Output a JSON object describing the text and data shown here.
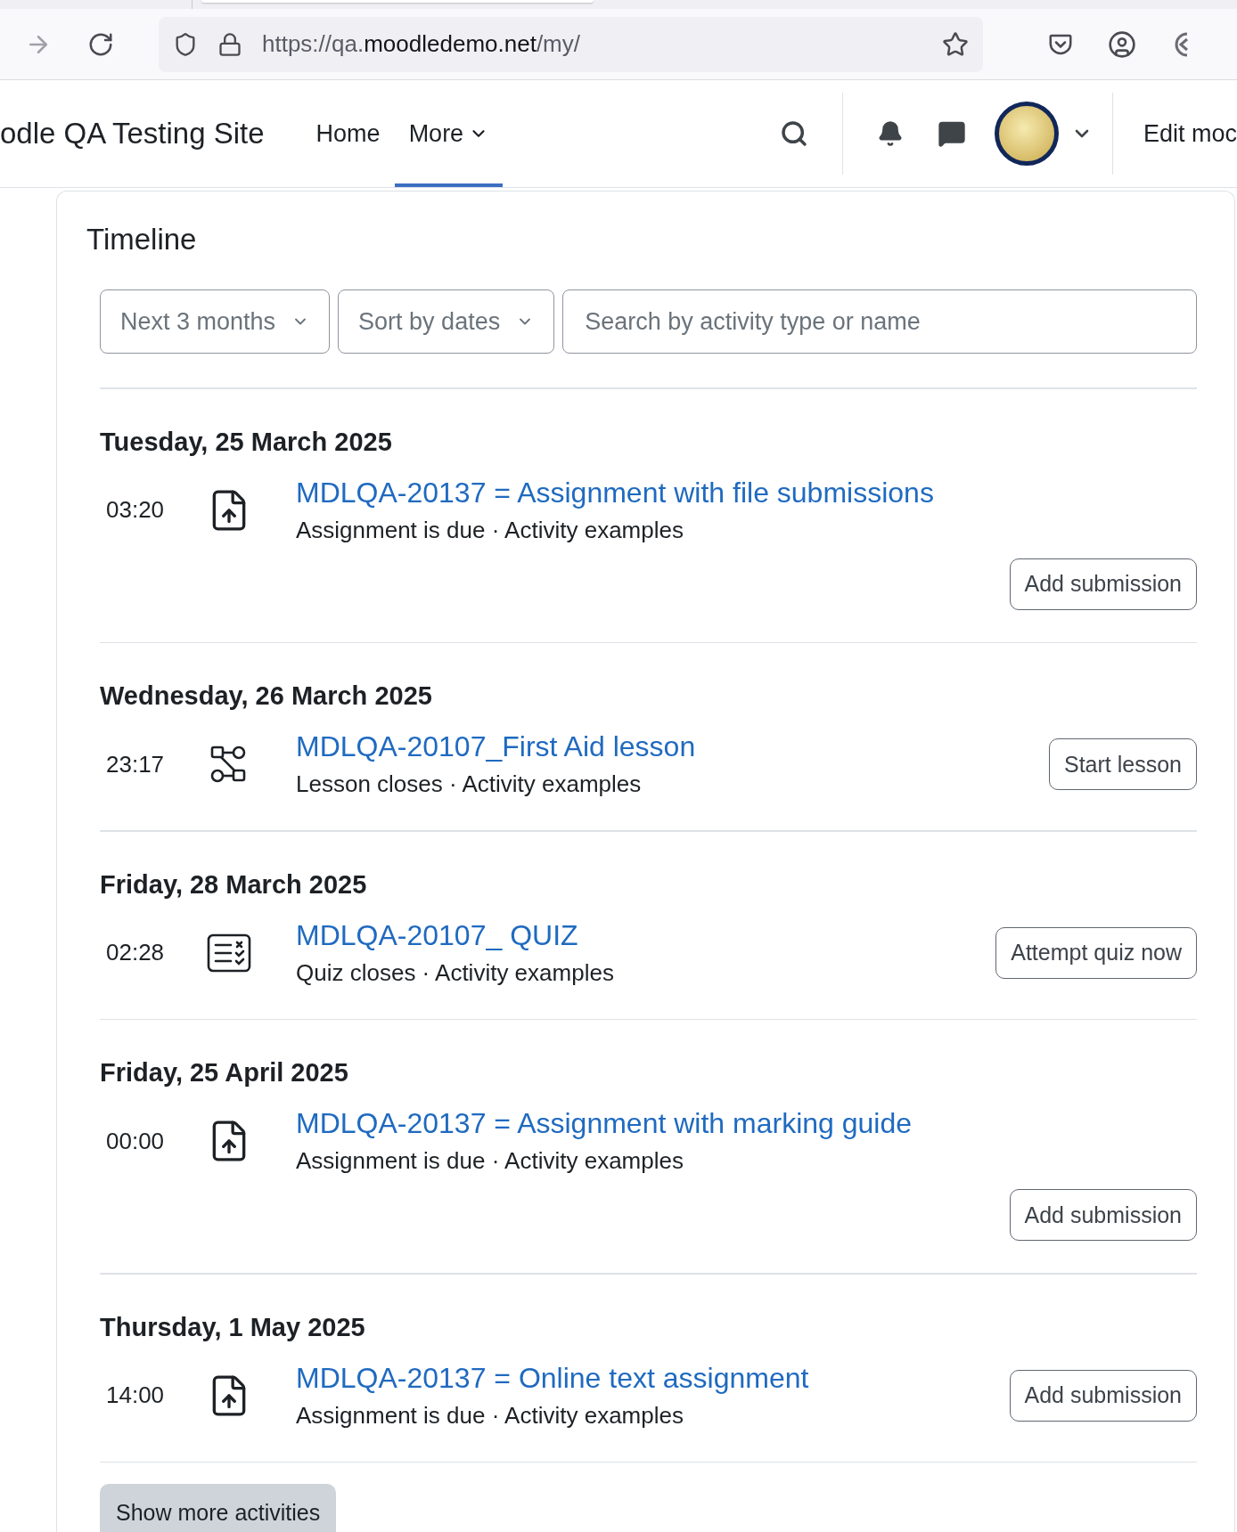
{
  "browser": {
    "url": {
      "prefix": "https://qa.",
      "domain": "moodledemo.net",
      "path": "/my/"
    }
  },
  "navbar": {
    "site_name": "odle QA Testing Site",
    "links": [
      {
        "label": "Home",
        "selected": false,
        "dropdown": false
      },
      {
        "label": "More",
        "selected": true,
        "dropdown": true
      }
    ],
    "edit_mode": "Edit moc"
  },
  "timeline": {
    "title": "Timeline",
    "filters": [
      {
        "label": "Next 3 months"
      },
      {
        "label": "Sort by dates"
      }
    ],
    "search": {
      "placeholder": "Search by activity type or name"
    },
    "days": [
      {
        "date": "Tuesday, 25 March 2025",
        "events": [
          {
            "time": "03:20",
            "kind": "assignment",
            "title": "MDLQA-20137 = Assignment with file submissions",
            "description": "Assignment is due · Activity examples",
            "action": "Add submission"
          }
        ]
      },
      {
        "date": "Wednesday, 26 March 2025",
        "events": [
          {
            "time": "23:17",
            "kind": "lesson",
            "title": "MDLQA-20107_First Aid lesson",
            "description": "Lesson closes · Activity examples",
            "action": "Start lesson"
          }
        ]
      },
      {
        "date": "Friday, 28 March 2025",
        "events": [
          {
            "time": "02:28",
            "kind": "quiz",
            "title": "MDLQA-20107_ QUIZ",
            "description": "Quiz closes · Activity examples",
            "action": "Attempt quiz now"
          }
        ]
      },
      {
        "date": "Friday, 25 April 2025",
        "events": [
          {
            "time": "00:00",
            "kind": "assignment",
            "title": "MDLQA-20137 = Assignment with marking guide",
            "description": "Assignment is due · Activity examples",
            "action": "Add submission"
          }
        ]
      },
      {
        "date": "Thursday, 1 May 2025",
        "events": [
          {
            "time": "14:00",
            "kind": "assignment",
            "title": "MDLQA-20137 = Online text assignment",
            "description": "Assignment is due · Activity examples",
            "action": "Add submission"
          }
        ]
      }
    ],
    "show_more": "Show more activities"
  }
}
